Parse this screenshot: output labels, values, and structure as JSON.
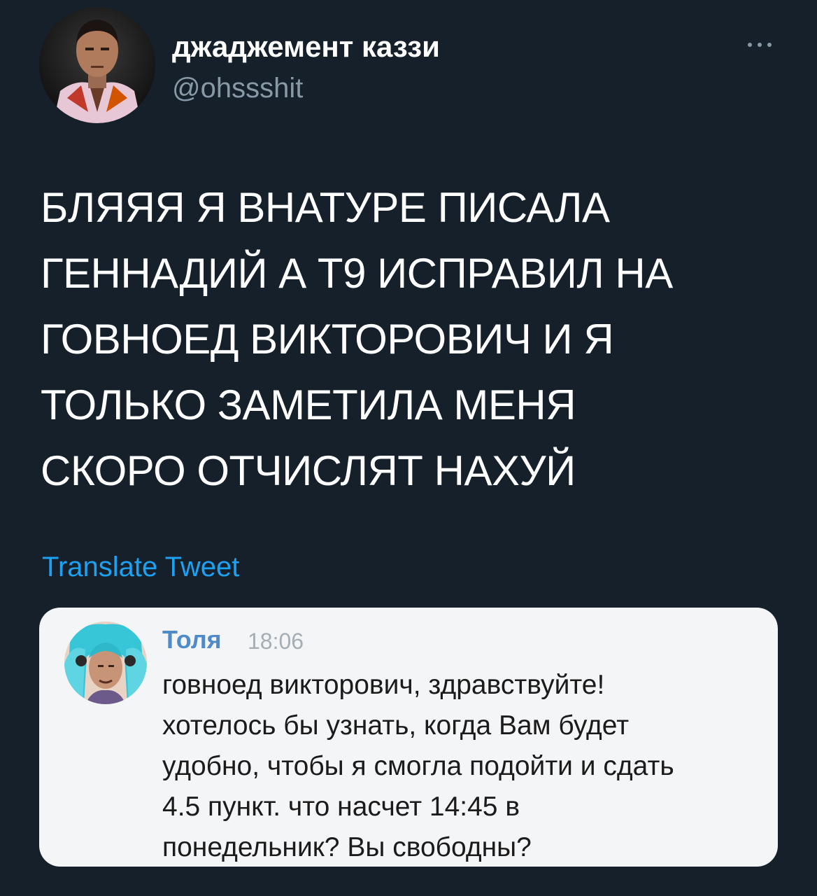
{
  "author": {
    "display_name": "джаджемент каззи",
    "handle": "@ohssshit"
  },
  "more_icon": "more-horizontal-icon",
  "tweet": {
    "lines": [
      "БЛЯЯЯ Я ВНАТУРЕ ПИСАЛА",
      "ГЕННАДИЙ А Т9 ИСПРАВИЛ НА",
      "ГОВНОЕД ВИКТОРОВИЧ И Я",
      "ТОЛЬКО ЗАМЕТИЛА МЕНЯ",
      "СКОРО ОТЧИСЛЯТ НАХУЙ"
    ]
  },
  "translate_label": "Translate Tweet",
  "message": {
    "sender": "Толя",
    "time": "18:06",
    "lines": [
      "говноед викторович, здравствуйте!",
      "хотелось бы узнать, когда Вам будет",
      "удобно, чтобы я смогла подойти и сдать",
      "4.5 пункт. что насчет 14:45 в",
      "понедельник? Вы свободны?"
    ]
  },
  "colors": {
    "background": "#15202b",
    "handle": "#8899a6",
    "link": "#1da1f2",
    "card": "#f4f5f7",
    "sender": "#4f8bc9"
  }
}
